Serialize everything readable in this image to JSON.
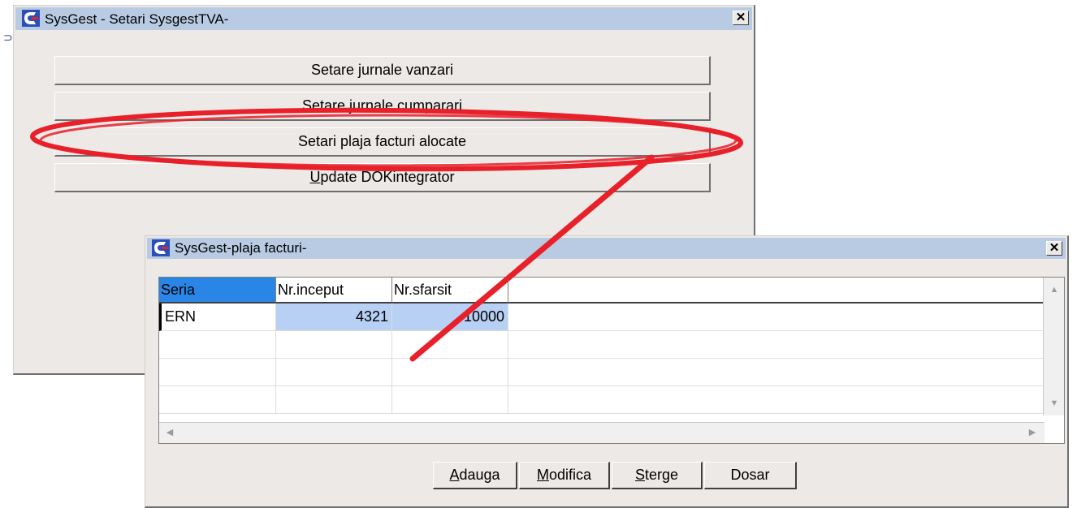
{
  "main_window": {
    "title": "SysGest - Setari SysgestTVA-",
    "close_label": "✕",
    "buttons": [
      {
        "pre": "Setare ",
        "key": "j",
        "post": "urnale vanzari"
      },
      {
        "pre": "Setare jurnale ",
        "key": "c",
        "post": "umparari"
      },
      {
        "pre": "Setari plaja facturi alocate",
        "key": "",
        "post": ""
      },
      {
        "pre": "",
        "key": "U",
        "post": "pdate DOKintegrator"
      }
    ]
  },
  "dialog": {
    "title": "SysGest-plaja facturi-",
    "close_label": "✕",
    "columns": [
      "Seria",
      "Nr.inceput",
      "Nr.sfarsit"
    ],
    "rows": [
      {
        "seria": "ERN",
        "nr_inceput": "4321",
        "nr_sfarsit": "10000"
      }
    ],
    "buttons": [
      {
        "key": "A",
        "post": "dauga"
      },
      {
        "key": "M",
        "post": "odifica"
      },
      {
        "key": "S",
        "post": "terge"
      },
      {
        "key": "",
        "post": "Dosar"
      }
    ]
  },
  "colors": {
    "titlebar": "#b9cbe3",
    "header_selected": "#2a86e6",
    "cell_selected": "#b8d0f4",
    "annotation": "#e8202a"
  },
  "icons": {
    "app": "sysgest-app-icon",
    "close": "close-icon",
    "scroll_up": "arrow-up-icon",
    "scroll_down": "arrow-down-icon",
    "scroll_left": "arrow-left-icon",
    "scroll_right": "arrow-right-icon"
  }
}
